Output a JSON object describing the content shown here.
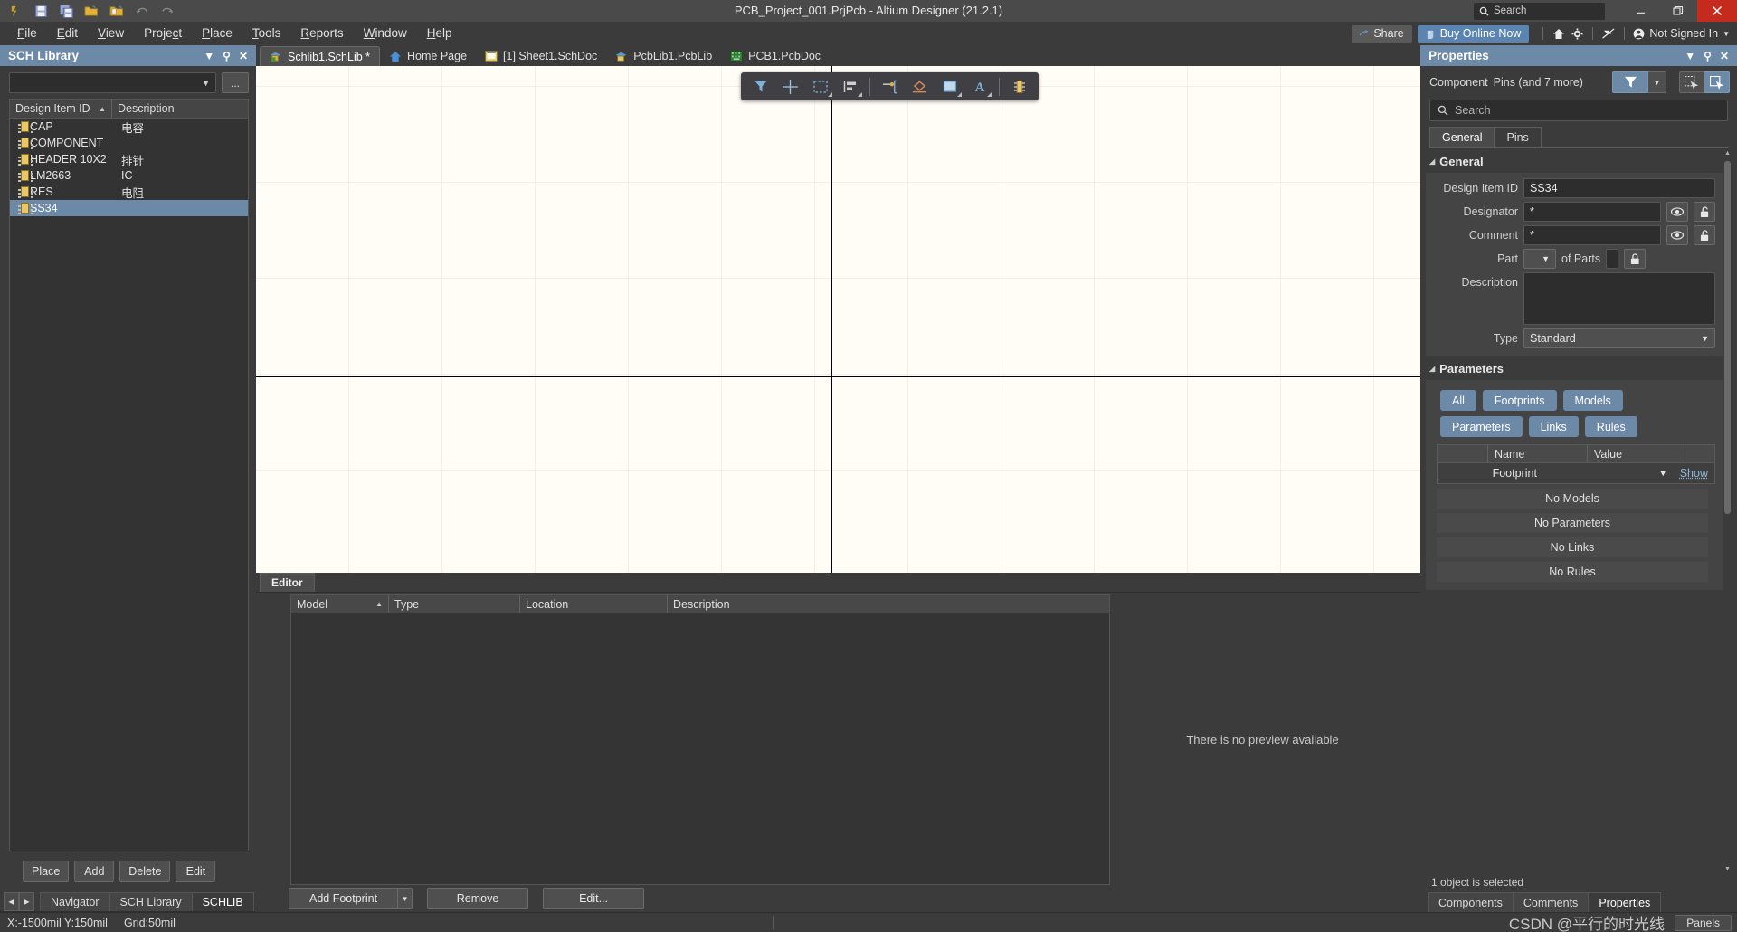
{
  "titlebar": {
    "title": "PCB_Project_001.PrjPcb - Altium Designer (21.2.1)",
    "search_placeholder": "Search",
    "minimize": "–",
    "restore": "❐",
    "close": "✕"
  },
  "quick_access": [
    {
      "name": "altium-logo-icon",
      "label": "Altium"
    },
    {
      "name": "save-icon",
      "label": "Save"
    },
    {
      "name": "save-all-icon",
      "label": "Save All"
    },
    {
      "name": "open-icon",
      "label": "Open"
    },
    {
      "name": "open-project-icon",
      "label": "Open Project"
    },
    {
      "name": "undo-icon",
      "label": "Undo"
    },
    {
      "name": "redo-icon",
      "label": "Redo"
    }
  ],
  "menubar": {
    "items": [
      {
        "label": "File",
        "accel": "F"
      },
      {
        "label": "Edit",
        "accel": "E"
      },
      {
        "label": "View",
        "accel": "V"
      },
      {
        "label": "Project",
        "accel": "c"
      },
      {
        "label": "Place",
        "accel": "P"
      },
      {
        "label": "Tools",
        "accel": "T"
      },
      {
        "label": "Reports",
        "accel": "R"
      },
      {
        "label": "Window",
        "accel": "W"
      },
      {
        "label": "Help",
        "accel": "H"
      }
    ],
    "share_label": "Share",
    "buy_label": "Buy Online Now",
    "signin_label": "Not Signed In"
  },
  "left_panel": {
    "title": "SCH Library",
    "library_combo_value": "",
    "dots_label": "...",
    "columns": [
      "Design Item ID",
      "Description"
    ],
    "rows": [
      {
        "id": "CAP",
        "description": "电容"
      },
      {
        "id": "COMPONENT",
        "description": ""
      },
      {
        "id": "HEADER 10X2",
        "description": "排针"
      },
      {
        "id": "LM2663",
        "description": "IC"
      },
      {
        "id": "RES",
        "description": "电阻"
      },
      {
        "id": "SS34",
        "description": "",
        "selected": true
      }
    ],
    "buttons": [
      "Place",
      "Add",
      "Delete",
      "Edit"
    ],
    "tabs": [
      {
        "label": "Navigator",
        "active": false
      },
      {
        "label": "SCH Library",
        "active": false
      },
      {
        "label": "SCHLIB",
        "active": true
      }
    ]
  },
  "doc_tabs": [
    {
      "label": "Schlib1.SchLib *",
      "icon": "schlib-icon",
      "active": true
    },
    {
      "label": "Home Page",
      "icon": "home-icon",
      "active": false
    },
    {
      "label": "[1] Sheet1.SchDoc",
      "icon": "schdoc-icon",
      "active": false
    },
    {
      "label": "PcbLib1.PcbLib",
      "icon": "pcblib-icon",
      "active": false
    },
    {
      "label": "PCB1.PcbDoc",
      "icon": "pcbdoc-icon",
      "active": false
    }
  ],
  "float_toolbar": [
    {
      "name": "filter-icon",
      "more": false
    },
    {
      "name": "crosshair-place-icon",
      "more": false
    },
    {
      "name": "selection-rect-icon",
      "more": true
    },
    {
      "name": "align-icon",
      "more": true
    },
    {
      "name": "place-pin-icon",
      "more": false
    },
    {
      "name": "place-polygon-icon",
      "more": false
    },
    {
      "name": "place-rectangle-icon",
      "more": true
    },
    {
      "name": "place-text-icon",
      "more": true
    },
    {
      "name": "place-component-icon",
      "more": false
    }
  ],
  "editor": {
    "tab_label": "Editor",
    "columns": [
      "Model",
      "Type",
      "Location",
      "Description"
    ],
    "rows": [],
    "preview_message": "There is no preview available",
    "add_footprint_label": "Add Footprint",
    "remove_label": "Remove",
    "edit_label": "Edit..."
  },
  "right_panel": {
    "title": "Properties",
    "object_type": "Component",
    "object_sub": "Pins (and 7 more)",
    "search_placeholder": "Search",
    "tabs": [
      {
        "label": "General",
        "active": true
      },
      {
        "label": "Pins",
        "active": false
      }
    ],
    "general": {
      "section_label": "General",
      "design_item_id_label": "Design Item ID",
      "design_item_id_value": "SS34",
      "designator_label": "Designator",
      "designator_value": "*",
      "comment_label": "Comment",
      "comment_value": "*",
      "part_label": "Part",
      "part_value": "",
      "of_parts_label": "of Parts",
      "of_parts_value": "",
      "description_label": "Description",
      "description_value": "",
      "type_label": "Type",
      "type_value": "Standard"
    },
    "parameters": {
      "section_label": "Parameters",
      "chips": [
        "All",
        "Footprints",
        "Models",
        "Parameters",
        "Links",
        "Rules"
      ],
      "columns": [
        "",
        "Name",
        "Value",
        ""
      ],
      "rows": [
        {
          "name": "Footprint",
          "value": "",
          "action": "Show"
        }
      ],
      "empty_states": [
        "No Models",
        "No Parameters",
        "No Links",
        "No Rules"
      ]
    },
    "status": "1 object is selected",
    "bottom_tabs": [
      {
        "label": "Components",
        "active": false
      },
      {
        "label": "Comments",
        "active": false
      },
      {
        "label": "Properties",
        "active": true
      }
    ]
  },
  "statusbar": {
    "coordinates": "X:-1500mil Y:150mil",
    "grid": "Grid:50mil",
    "watermark": "CSDN @平行的时光线",
    "panels_label": "Panels"
  },
  "colors": {
    "accent_blue": "#6c89a8",
    "titlebar_bg": "#4a4a4a",
    "app_bg": "#3b3b3b",
    "canvas_bg": "#fffdf5",
    "close_red": "#c42b1c"
  }
}
